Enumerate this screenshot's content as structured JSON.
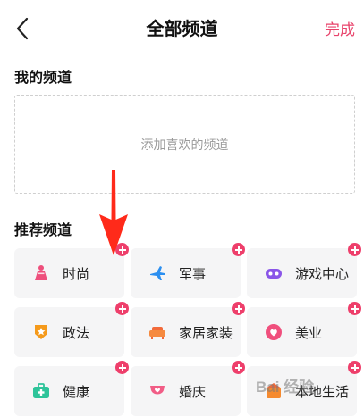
{
  "header": {
    "title": "全部频道",
    "done_label": "完成"
  },
  "my_channels": {
    "title": "我的频道",
    "empty_hint": "添加喜欢的频道"
  },
  "recommended": {
    "title": "推荐频道",
    "items": [
      {
        "label": "时尚",
        "icon": "dress-icon"
      },
      {
        "label": "军事",
        "icon": "jet-icon"
      },
      {
        "label": "游戏中心",
        "icon": "game-controller-icon"
      },
      {
        "label": "政法",
        "icon": "badge-icon"
      },
      {
        "label": "家居家装",
        "icon": "sofa-icon"
      },
      {
        "label": "美业",
        "icon": "beauty-icon"
      },
      {
        "label": "健康",
        "icon": "first-aid-kit-icon"
      },
      {
        "label": "婚庆",
        "icon": "wedding-icon"
      },
      {
        "label": "本地生活",
        "icon": "local-life-icon"
      }
    ]
  },
  "colors": {
    "accent": "#e8436b",
    "tile_bg": "#f5f5f6",
    "annotation_arrow": "#ff2a1a"
  },
  "watermark": "Bai 经验"
}
